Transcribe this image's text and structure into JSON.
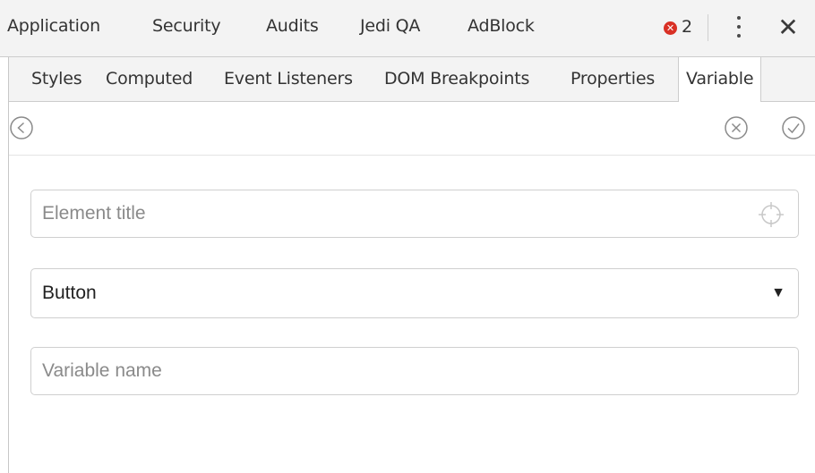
{
  "top_tabs": [
    "Application",
    "Security",
    "Audits",
    "Jedi QA",
    "AdBlock"
  ],
  "errors": {
    "count": "2"
  },
  "icons": {
    "error": "error-circle-icon",
    "more": "kebab-menu-icon",
    "close": "close-icon",
    "back": "back-circle-icon",
    "cancel": "cancel-circle-icon",
    "confirm": "check-circle-icon",
    "target": "crosshair-icon"
  },
  "sub_tabs": [
    "Styles",
    "Computed",
    "Event Listeners",
    "DOM Breakpoints",
    "Properties",
    "Variable"
  ],
  "active_sub_tab": "Variable",
  "form": {
    "element_title": {
      "value": "",
      "placeholder": "Element title"
    },
    "element_type": {
      "selected": "Button"
    },
    "variable_name": {
      "value": "",
      "placeholder": "Variable name"
    }
  },
  "colors": {
    "error": "#d93025",
    "toolbar_bg": "#f3f3f3",
    "border": "#cccccc"
  }
}
